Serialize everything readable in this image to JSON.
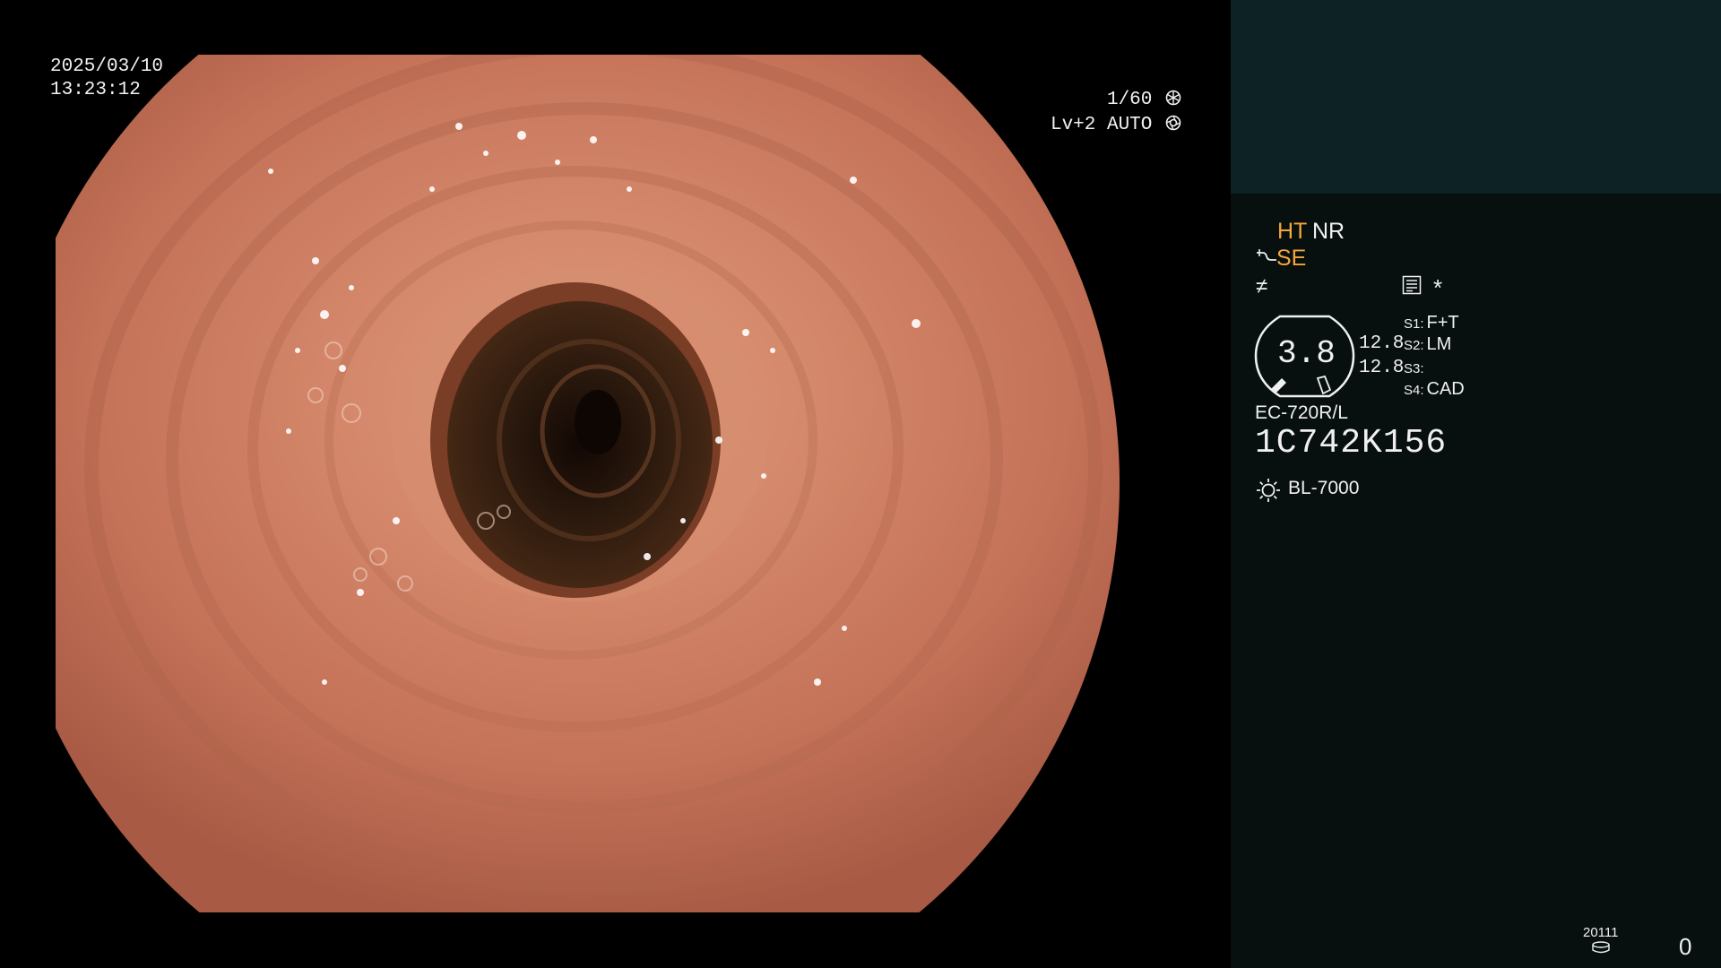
{
  "overlay": {
    "date": "2025/03/10",
    "time": "13:23:12",
    "shutter": "1/60",
    "shutter_icon": "shutter-icon",
    "level": "Lv+2 AUTO",
    "level_icon": "iris-icon"
  },
  "panel": {
    "modes": {
      "ht": "HT",
      "nr": "NR",
      "se": "SE",
      "se_icon": "enhance-curve-icon",
      "slash_icon": "contrast-slash-icon",
      "menu_icon": "menu-list-icon",
      "star": "*"
    },
    "gauge": {
      "value": "3.8",
      "readings": [
        "12.8",
        "12.8"
      ]
    },
    "slots": [
      {
        "key": "S1:",
        "value": "F+T"
      },
      {
        "key": "S2:",
        "value": "LM"
      },
      {
        "key": "S3:",
        "value": ""
      },
      {
        "key": "S4:",
        "value": "CAD"
      }
    ],
    "scope_model": "EC-720R/L",
    "scope_serial": "1C742K156",
    "light_source": "BL-7000",
    "light_icon": "light-bulb-icon",
    "record_code": "20111",
    "record_icon": "disk-icon",
    "record_count": "0"
  },
  "colors": {
    "panel_bg": "#070f0f",
    "thumb_bg": "#0c2224",
    "accent_amber": "#f3a63a",
    "mucosa": "#c8785e",
    "lumen": "#2a160c"
  }
}
